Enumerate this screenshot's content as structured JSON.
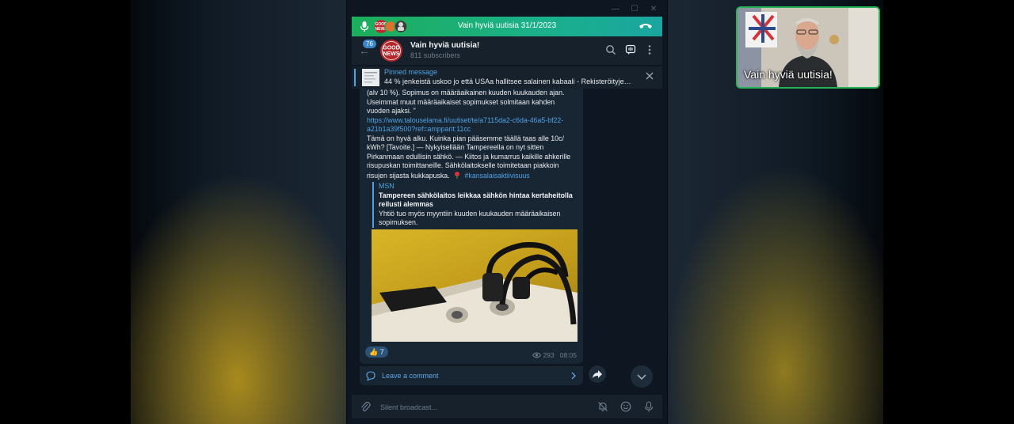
{
  "call": {
    "title": "Vain hyviä uutisia 31/1/2023"
  },
  "header": {
    "channel_name": "Vain hyviä uutisia!",
    "subscribers": "811 subscribers",
    "unread_count": "76",
    "avatar_text_top": "GOOD",
    "avatar_text_bottom": "NEWS"
  },
  "pinned": {
    "title": "Pinned message",
    "text": "44 % jenkeistä uskoo jo että USAa hallitsee salainen kabaali - Rekisteröityjen ä..."
  },
  "message": {
    "line1": "(alv 10 %). Sopimus on määräaikainen kuuden kuukauden ajan.",
    "line2": "Useimmat muut määräaikaiset sopimukset solmitaan kahden",
    "line3": "vuoden ajaksi. \"",
    "link1": "https://www.talouselama.fi/uutiset/te/a7115da2-c6da-46a5-bf22-",
    "link2": "a21b1a39f500?ref=ampparit:11cc",
    "line4": "Tämä on hyvä alku. Kuinka pian pääsemme täällä taas alle 10c/",
    "line5": "kWh? [Tavoite.] — Nykyisellään Tampereella on nyt sitten",
    "line6": "Pirkanmaan edullisin sähkö. — Kiitos ja kumarrus kaikille ahkerille",
    "line7": "risupuskan toimittaneille. Sähkölaitokselle toimitetaan piakkoin",
    "line8": "risujen sijasta kukkapuska.",
    "hashtag": "#kansalaisaktiivisuus",
    "preview": {
      "source": "MSN",
      "title_line1": "Tampereen sähkölaitos leikkaa sähkön hintaa kertaheitolla",
      "title_line2": "reilusti alemmas",
      "desc_line1": "Yhtiö tuo myös myyntiin kuuden kuukauden määräaikaisen",
      "desc_line2": "sopimuksen."
    },
    "reaction_emoji": "👍",
    "reaction_count": "7",
    "views": "293",
    "time": "08:05"
  },
  "comments": {
    "label": "Leave a comment"
  },
  "input": {
    "placeholder": "Silent broadcast..."
  },
  "video": {
    "participant_name": "Vain hyviä uutisia!"
  },
  "colors": {
    "call_bar": "#1cae5a",
    "accent": "#4fa3e3",
    "bubble": "#182533",
    "window_bg": "#0e1621",
    "panel": "#17212b",
    "video_border": "#26b356"
  }
}
